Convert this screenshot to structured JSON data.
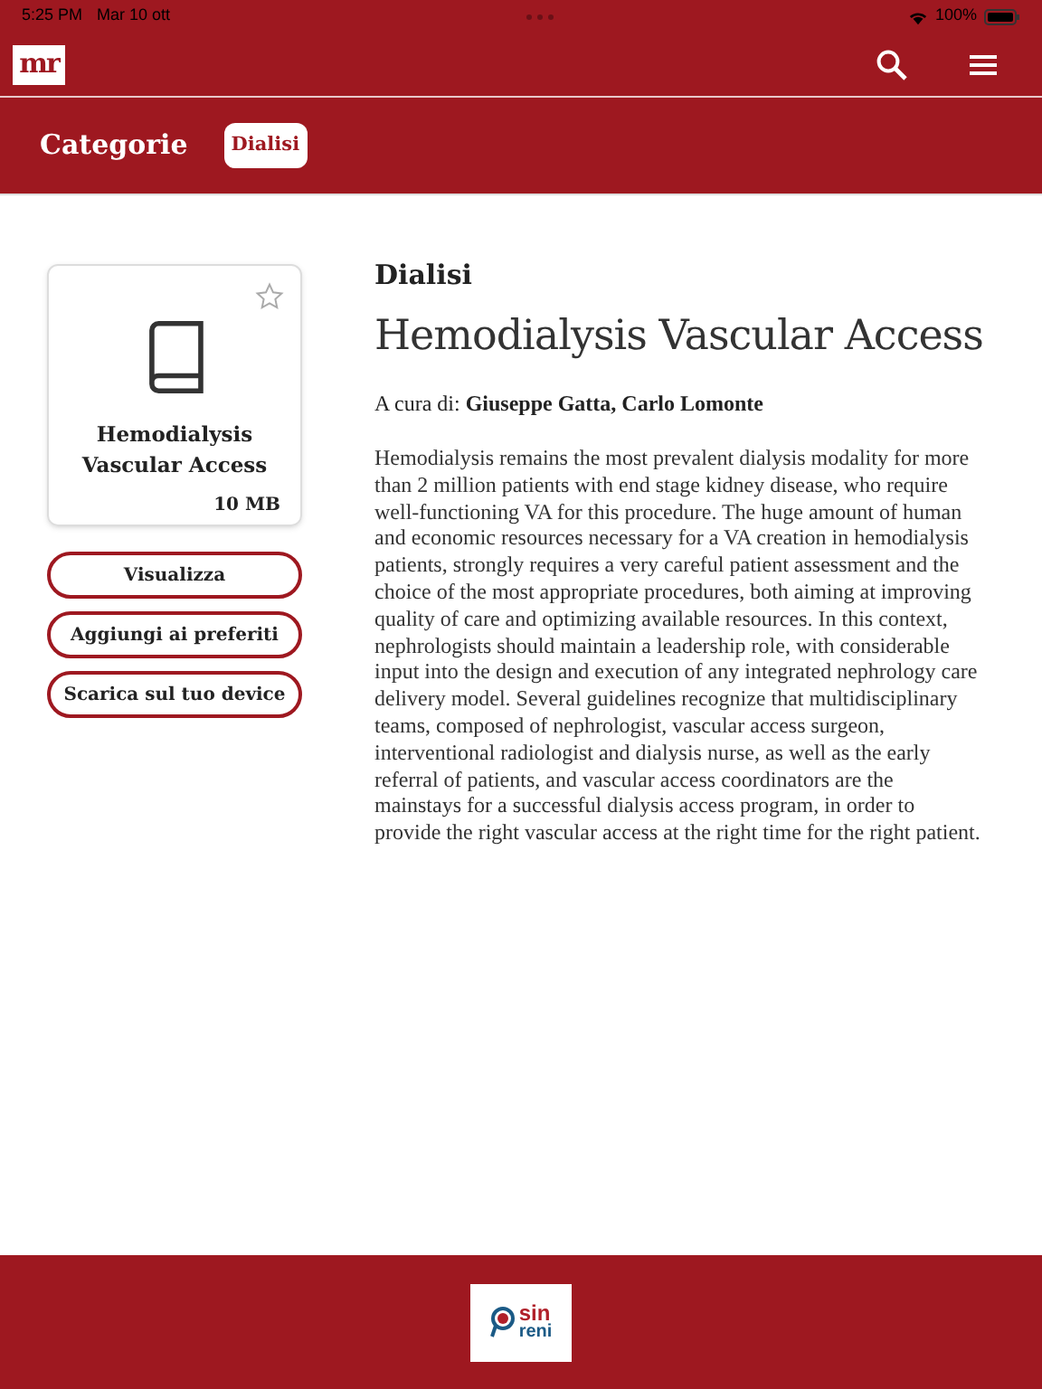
{
  "status_bar": {
    "time": "5:25 PM",
    "date": "Mar 10 ott",
    "battery": "100%"
  },
  "header": {
    "logo": "mr"
  },
  "category_bar": {
    "title": "Categorie",
    "chips": [
      {
        "label": "Dialisi",
        "selected": true
      }
    ]
  },
  "book_card": {
    "title": "Hemodialysis Vascular Access",
    "size": "10 MB",
    "starred": false
  },
  "actions": [
    "Visualizza",
    "Aggiungi ai preferiti",
    "Scarica sul tuo device"
  ],
  "article": {
    "category": "Dialisi",
    "title": "Hemodialysis Vascular Access",
    "editors": "A cura di: **Giuseppe Gatta, Carlo Lomonte**",
    "abstract": "Hemodialysis remains the most prevalent dialysis modality for more than 2 million patients with end stage kidney disease, who require well-functioning VA for this procedure. The huge amount of human and economic resources necessary for a VA creation in hemodialysis patients, strongly requires a very careful patient assessment and the choice of the most appropriate procedures, both aiming at improving quality of care and optimizing available resources. In this context, nephrologists should maintain a leadership role, with considerable input into the design and execution of any integrated nephrology care delivery model. Several guidelines recognize that multidisciplinary teams, composed of nephrologist, vascular access surgeon, interventional radiologist and dialysis nurse, as well as the early referral of patients, and vascular access coordinators are the mainstays for a successful dialysis access program, in order to provide the right vascular access at the right time for the right patient."
  },
  "footer": {
    "logo_top": "sin",
    "logo_bottom": "reni"
  }
}
